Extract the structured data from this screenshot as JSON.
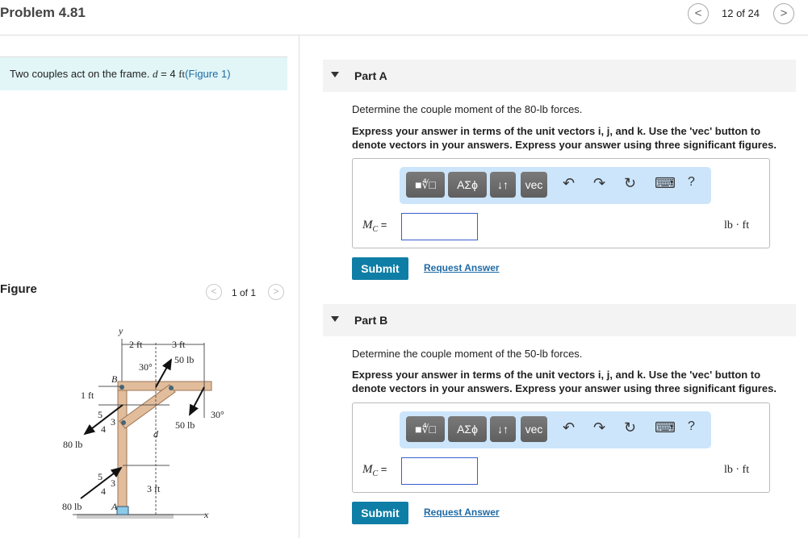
{
  "header": {
    "title": "Problem 4.81",
    "position": "12 of 24",
    "prev_icon": "chevron-left-icon",
    "next_icon": "chevron-right-icon"
  },
  "intro": {
    "text": "Two couples act on the frame. ",
    "var": "d",
    "eq": " = 4 ",
    "unit": "ft",
    ".": ". ",
    "link": "(Figure 1)"
  },
  "figure": {
    "label": "Figure",
    "position": "1 of 1",
    "labels": {
      "y": "y",
      "x": "x",
      "B": "B",
      "A": "A",
      "d": "d",
      "dim_2ft": "2 ft",
      "dim_3ft_top": "3 ft",
      "dim_1ft": "1 ft",
      "dim_3ft": "3 ft",
      "f50_top": "50 lb",
      "f50_bot": "50 lb",
      "ang_top": "30°",
      "ang_bot": "30°",
      "f80_top": "80 lb",
      "f80_bot": "80 lb",
      "s5": "5",
      "s3": "3",
      "s4": "4"
    }
  },
  "parts": [
    {
      "label": "Part A",
      "question": "Determine the couple moment of the 80-lb forces.",
      "instructions": "Express your answer in terms of the unit vectors i, j, and k. Use the 'vec' button to denote vectors in your answers. Express your answer using three significant figures.",
      "var_label": "M",
      "var_sub": "C",
      "eq": " =",
      "input_value": "",
      "unit": "lb · ft",
      "submit": "Submit",
      "request": "Request Answer"
    },
    {
      "label": "Part B",
      "question": "Determine the couple moment of the 50-lb forces.",
      "instructions": "Express your answer in terms of the unit vectors i, j, and k. Use the 'vec' button to denote vectors in your answers. Express your answer using three significant figures.",
      "var_label": "M",
      "var_sub": "C",
      "eq": " =",
      "input_value": "",
      "unit": "lb · ft",
      "submit": "Submit",
      "request": "Request Answer"
    }
  ],
  "toolbar": {
    "templates": "■∜□",
    "greek": "ΑΣϕ",
    "arrows": "↓↑",
    "vec": "vec",
    "undo": "↶",
    "redo": "↷",
    "reset": "↻",
    "keyboard": "⌨",
    "help": "?"
  },
  "colors": {
    "accent": "#0f7ea6",
    "toolbar_bg": "#cce5fb",
    "intro_bg": "#e2f6f7"
  }
}
